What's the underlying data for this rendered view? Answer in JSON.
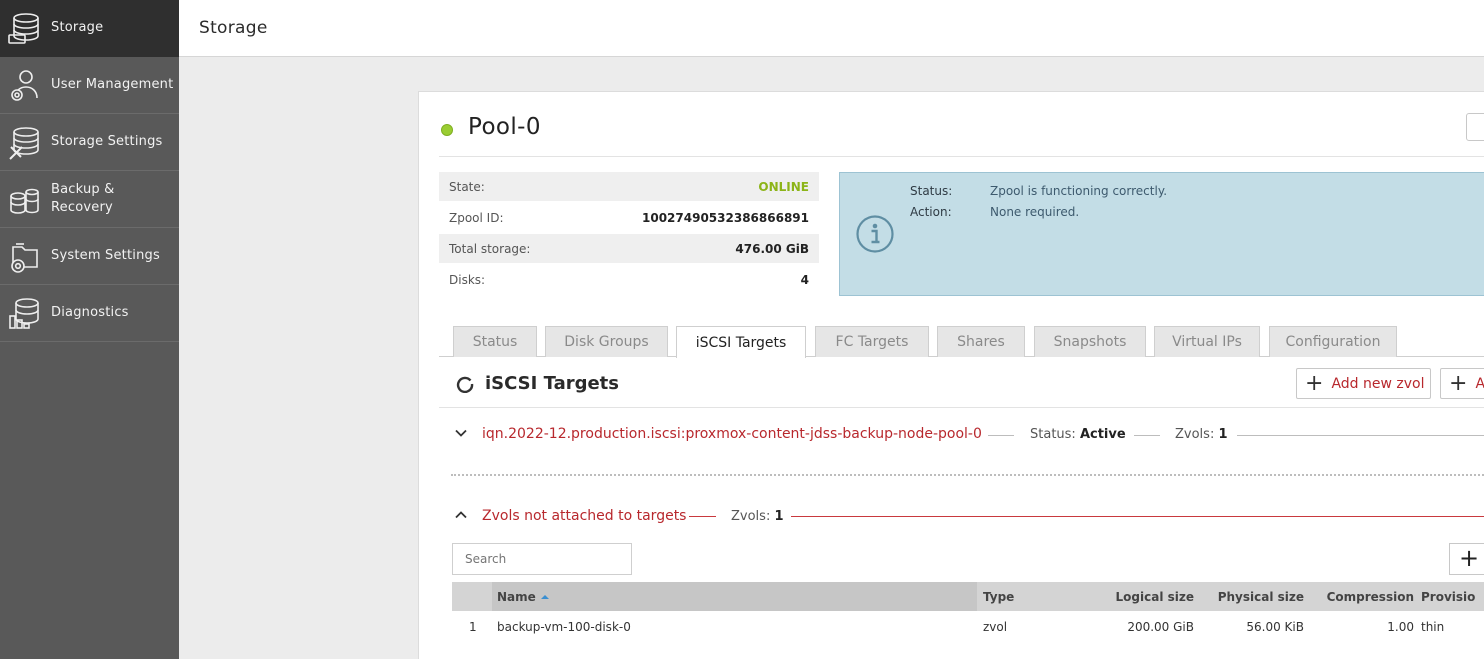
{
  "sidebar": {
    "items": [
      {
        "label": "Storage",
        "icon": "database-icon",
        "active": true
      },
      {
        "label": "User Management",
        "icon": "user-gear-icon"
      },
      {
        "label": "Storage Settings",
        "icon": "database-tools-icon"
      },
      {
        "label": "Backup &\nRecovery",
        "icon": "database-stack-icon"
      },
      {
        "label": "System Settings",
        "icon": "folder-gear-icon"
      },
      {
        "label": "Diagnostics",
        "icon": "database-chart-icon"
      }
    ]
  },
  "header": {
    "title": "Storage"
  },
  "pool": {
    "name": "Pool-0",
    "status_color": "#9acd32",
    "info": [
      {
        "key": "State:",
        "value": "ONLINE"
      },
      {
        "key": "Zpool ID:",
        "value": "10027490532386866891"
      },
      {
        "key": "Total storage:",
        "value": "476.00 GiB"
      },
      {
        "key": "Disks:",
        "value": "4"
      }
    ],
    "status_box": {
      "status_label": "Status:",
      "status_value": "Zpool is functioning correctly.",
      "action_label": "Action:",
      "action_value": "None required."
    }
  },
  "tabs": [
    {
      "label": "Status"
    },
    {
      "label": "Disk Groups"
    },
    {
      "label": "iSCSI Targets",
      "active": true
    },
    {
      "label": "FC Targets"
    },
    {
      "label": "Shares"
    },
    {
      "label": "Snapshots"
    },
    {
      "label": "Virtual IPs"
    },
    {
      "label": "Configuration"
    }
  ],
  "section": {
    "title": "iSCSI Targets",
    "add_zvol_label": "Add new zvol",
    "add_second_label": "A"
  },
  "target": {
    "name": "iqn.2022-12.production.iscsi:proxmox-content-jdss-backup-node-pool-0",
    "status_label": "Status:",
    "status_value": "Active",
    "zvols_label": "Zvols:",
    "zvols_value": "1"
  },
  "unattached": {
    "title": "Zvols not attached to targets",
    "zvols_label": "Zvols:",
    "zvols_value": "1",
    "search_placeholder": "Search"
  },
  "table": {
    "columns": [
      "Name",
      "Type",
      "Logical size",
      "Physical size",
      "Compression",
      "Provisio"
    ],
    "rows": [
      {
        "index": "1",
        "name": "backup-vm-100-disk-0",
        "type": "zvol",
        "logical": "200.00 GiB",
        "physical": "56.00 KiB",
        "compression": "1.00",
        "provisioning": "thin"
      }
    ]
  },
  "colors": {
    "accent_red": "#b8282d",
    "online_green": "#8cb418",
    "sidebar_bg": "#595959"
  }
}
